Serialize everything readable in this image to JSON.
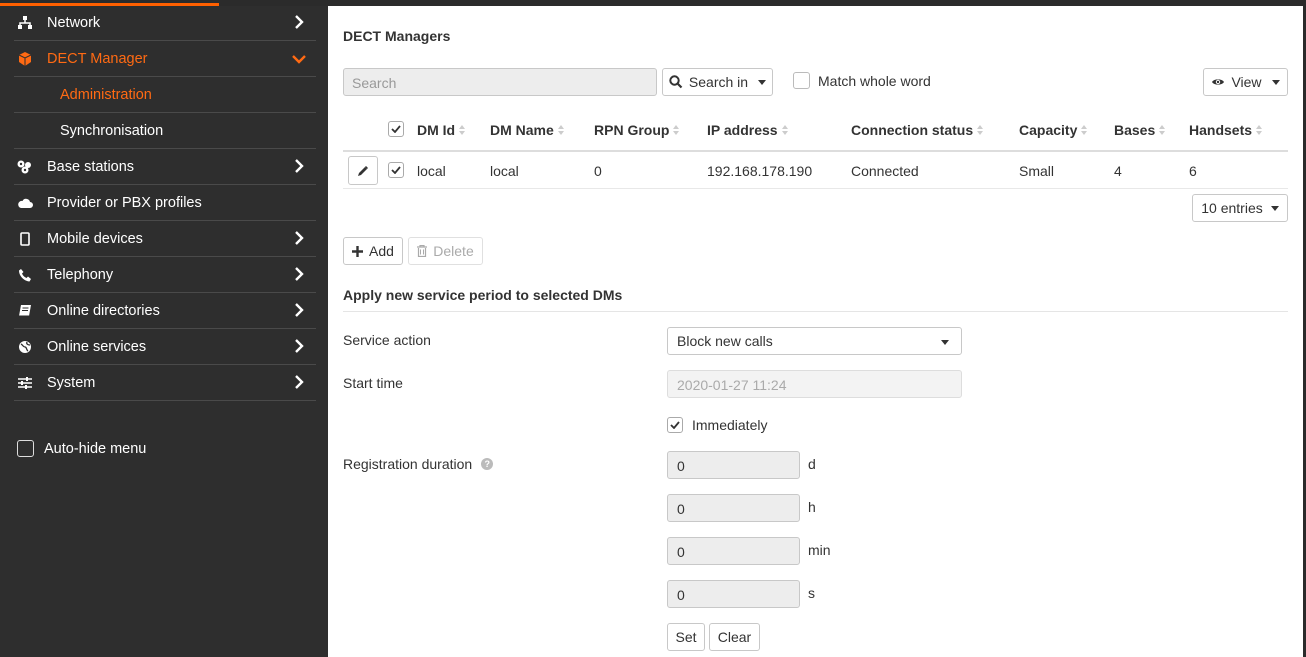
{
  "sidebar": {
    "items": [
      {
        "label": "Network",
        "icon": "network-icon"
      },
      {
        "label": "DECT Manager",
        "icon": "cube-icon"
      },
      {
        "label": "Administration"
      },
      {
        "label": "Synchronisation"
      },
      {
        "label": "Base stations",
        "icon": "base-stations-icon"
      },
      {
        "label": "Provider or PBX profiles",
        "icon": "cloud-icon"
      },
      {
        "label": "Mobile devices",
        "icon": "mobile-icon"
      },
      {
        "label": "Telephony",
        "icon": "phone-icon"
      },
      {
        "label": "Online directories",
        "icon": "book-icon"
      },
      {
        "label": "Online services",
        "icon": "globe-icon"
      },
      {
        "label": "System",
        "icon": "sliders-icon"
      }
    ],
    "autohide_label": "Auto-hide menu"
  },
  "colors": {
    "accent": "#ff6a13",
    "sidebar_bg": "#2e2e2e"
  },
  "main": {
    "title": "DECT Managers",
    "search_placeholder": "Search",
    "search_in_label": "Search in",
    "match_whole_word_label": "Match whole word",
    "view_label": "View",
    "table": {
      "columns": [
        "DM Id",
        "DM Name",
        "RPN Group",
        "IP address",
        "Connection status",
        "Capacity",
        "Bases",
        "Handsets"
      ],
      "rows": [
        [
          "local",
          "local",
          "0",
          "192.168.178.190",
          "Connected",
          "Small",
          "4",
          "6"
        ]
      ]
    },
    "entries_label": "10 entries",
    "add_label": "Add",
    "delete_label": "Delete",
    "service_section_title": "Apply new service period to selected DMs",
    "service_action_label": "Service action",
    "service_action_value": "Block new calls",
    "start_time_label": "Start time",
    "start_time_placeholder": "2020-01-27 11:24",
    "immediately_label": "Immediately",
    "registration_duration_label": "Registration duration",
    "durations": [
      {
        "value": "0",
        "unit": "d"
      },
      {
        "value": "0",
        "unit": "h"
      },
      {
        "value": "0",
        "unit": "min"
      },
      {
        "value": "0",
        "unit": "s"
      }
    ],
    "set_label": "Set",
    "clear_label": "Clear"
  }
}
